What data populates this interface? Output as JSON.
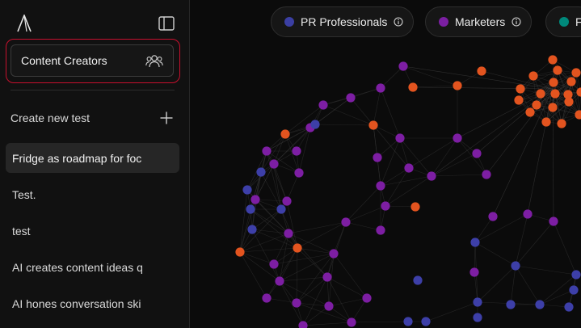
{
  "sidebar": {
    "audience": {
      "label": "Content Creators",
      "icon": "users-icon"
    },
    "create": {
      "label": "Create new test",
      "icon": "plus-icon"
    },
    "tests": [
      {
        "label": "Fridge as roadmap for foc",
        "active": true
      },
      {
        "label": "Test.",
        "active": false
      },
      {
        "label": "test",
        "active": false
      },
      {
        "label": "AI creates content ideas q",
        "active": false
      },
      {
        "label": "AI hones conversation ski",
        "active": false
      }
    ]
  },
  "filters": [
    {
      "label": "PR Professionals",
      "color": "#3b3fa3",
      "icon": "info-icon"
    },
    {
      "label": "Marketers",
      "color": "#7b1fa2",
      "icon": "info-icon"
    },
    {
      "label": "F",
      "color": "#00897b",
      "icon": "info-icon"
    }
  ],
  "colors": {
    "orange": "#e3541f",
    "purple": "#7d1ea3",
    "blue": "#3d3fa8",
    "teal": "#00897b",
    "highlight": "#c8102e"
  }
}
